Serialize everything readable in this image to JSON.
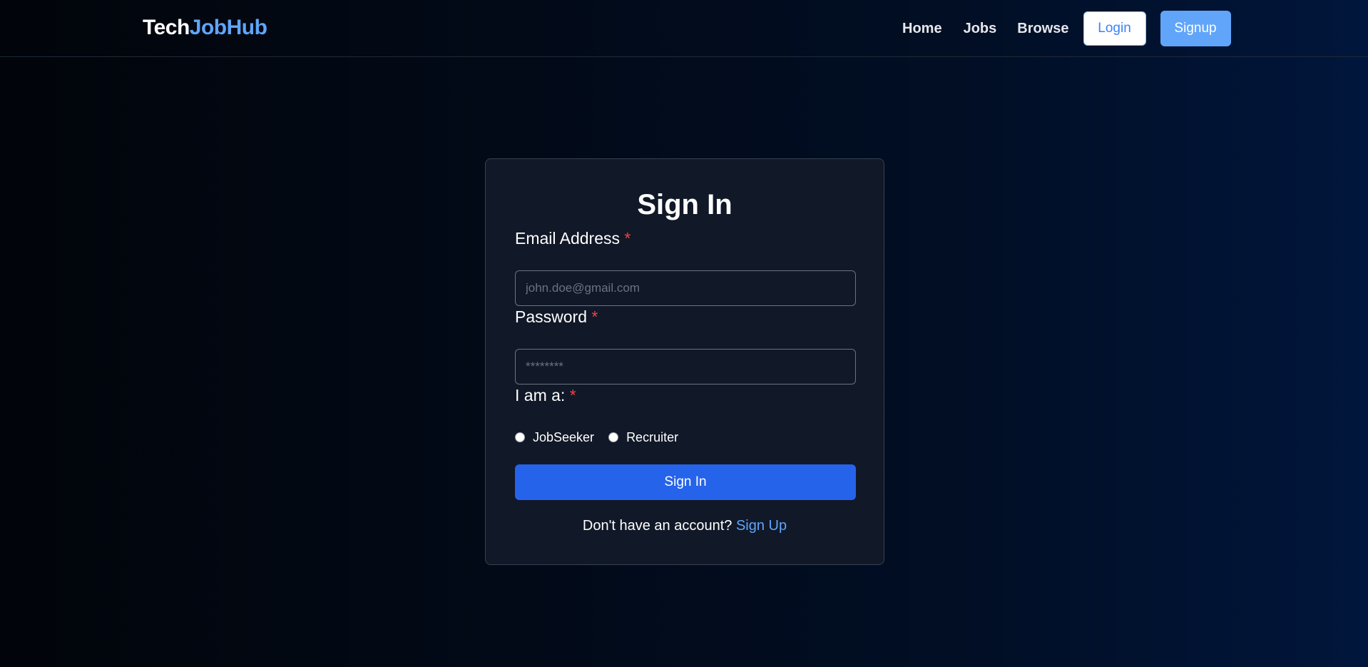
{
  "header": {
    "brand_part1": "Tech",
    "brand_part2": "JobHub",
    "nav": {
      "home": "Home",
      "jobs": "Jobs",
      "browse": "Browse"
    },
    "login_label": "Login",
    "signup_label": "Signup"
  },
  "form": {
    "title": "Sign In",
    "email": {
      "label": "Email Address",
      "required_mark": "*",
      "placeholder": "john.doe@gmail.com",
      "value": ""
    },
    "password": {
      "label": "Password",
      "required_mark": "*",
      "placeholder": "********",
      "value": ""
    },
    "role": {
      "label": "I am a:",
      "required_mark": "*",
      "options": [
        {
          "label": "JobSeeker",
          "selected": false
        },
        {
          "label": "Recruiter",
          "selected": false
        }
      ]
    },
    "submit_label": "Sign In",
    "footer_prompt": "Don't have an account?",
    "footer_link": "Sign Up"
  },
  "colors": {
    "accent": "#60a5fa",
    "primary_button": "#2563eb",
    "required": "#ef4444",
    "card_bg": "#111827"
  }
}
